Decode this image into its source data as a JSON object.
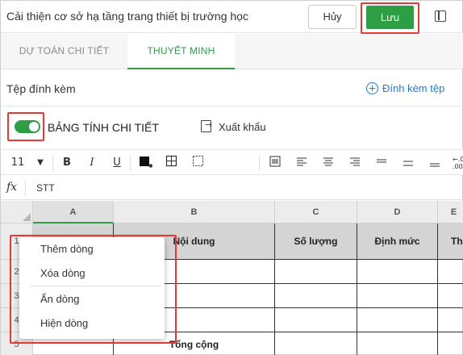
{
  "header": {
    "title": "Cải thiện cơ sở hạ tầng trang thiết bị trường học",
    "cancel_label": "Hủy",
    "save_label": "Lưu"
  },
  "tabs": [
    {
      "label": "DỰ TOÁN CHI TIẾT",
      "active": false
    },
    {
      "label": "THUYẾT MINH",
      "active": true
    }
  ],
  "attachments": {
    "label": "Tệp đính kèm",
    "add_label": "Đính kèm tệp"
  },
  "sheet_toolbar": {
    "toggle_on": true,
    "toggle_label": "BẢNG TÍNH CHI TIẾT",
    "export_label": "Xuất khẩu"
  },
  "format_toolbar": {
    "font_size": "11",
    "bold": "B",
    "italic": "I",
    "underline": "U",
    "more": "←.0\n.00"
  },
  "formula_bar": {
    "fx_label": "fx",
    "value": "STT"
  },
  "grid": {
    "columns": [
      "A",
      "B",
      "C",
      "D",
      "E"
    ],
    "header_cells": [
      "",
      "Nội dung",
      "Số lượng",
      "Định mức",
      "Th"
    ],
    "rows": [
      "1",
      "2",
      "3",
      "4",
      "5"
    ],
    "total_label": "Tổng cộng"
  },
  "context_menu": {
    "items": [
      "Thêm dòng",
      "Xóa dòng",
      "Ẩn dòng",
      "Hiện dòng"
    ]
  },
  "colors": {
    "accent": "#2e9e45",
    "highlight": "#e53935",
    "link": "#1e7bd0"
  }
}
